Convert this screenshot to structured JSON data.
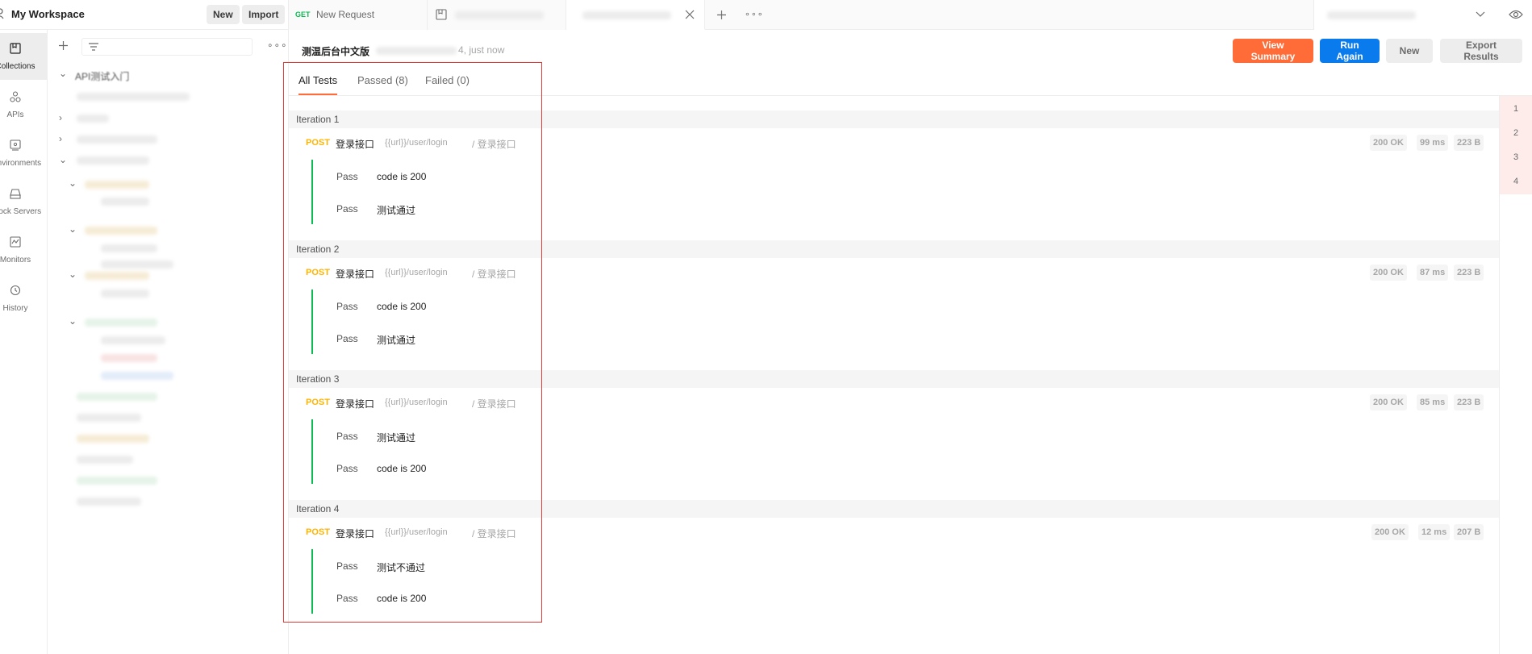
{
  "workspace": {
    "title": "My Workspace",
    "new_label": "New",
    "import_label": "Import"
  },
  "rail": [
    {
      "label": "Collections",
      "icon": "collections-icon"
    },
    {
      "label": "APIs",
      "icon": "apis-icon"
    },
    {
      "label": "Environments",
      "icon": "environments-icon"
    },
    {
      "label": "Mock Servers",
      "icon": "mock-servers-icon"
    },
    {
      "label": "Monitors",
      "icon": "monitors-icon"
    },
    {
      "label": "History",
      "icon": "history-icon"
    }
  ],
  "collections": {
    "first_label": "API测试入门"
  },
  "tabs": [
    {
      "method": "GET",
      "name": "New Request"
    }
  ],
  "runner": {
    "title": "测温后台中文版",
    "meta": "4, just now",
    "view_summary": "View Summary",
    "run_again": "Run Again",
    "new_label": "New",
    "export": "Export Results"
  },
  "result_tabs": {
    "all": "All Tests",
    "passed": "Passed (8)",
    "failed": "Failed (0)"
  },
  "iterations": [
    {
      "label": "Iteration 1",
      "method": "POST",
      "name": "登录接口",
      "url": "{{url}}/user/login",
      "path": "/ 登录接口",
      "status": "200 OK",
      "time": "99 ms",
      "size": "223 B",
      "tests": [
        {
          "result": "Pass",
          "name": "code is 200"
        },
        {
          "result": "Pass",
          "name": "测试通过"
        }
      ]
    },
    {
      "label": "Iteration 2",
      "method": "POST",
      "name": "登录接口",
      "url": "{{url}}/user/login",
      "path": "/ 登录接口",
      "status": "200 OK",
      "time": "87 ms",
      "size": "223 B",
      "tests": [
        {
          "result": "Pass",
          "name": "code is 200"
        },
        {
          "result": "Pass",
          "name": "测试通过"
        }
      ]
    },
    {
      "label": "Iteration 3",
      "method": "POST",
      "name": "登录接口",
      "url": "{{url}}/user/login",
      "path": "/ 登录接口",
      "status": "200 OK",
      "time": "85 ms",
      "size": "223 B",
      "tests": [
        {
          "result": "Pass",
          "name": "测试通过"
        },
        {
          "result": "Pass",
          "name": "code is 200"
        }
      ]
    },
    {
      "label": "Iteration 4",
      "method": "POST",
      "name": "登录接口",
      "url": "{{url}}/user/login",
      "path": "/ 登录接口",
      "status": "200 OK",
      "time": "12 ms",
      "size": "207 B",
      "tests": [
        {
          "result": "Pass",
          "name": "测试不通过"
        },
        {
          "result": "Pass",
          "name": "code is 200"
        }
      ]
    }
  ],
  "gutter": [
    "1",
    "2",
    "3",
    "4"
  ],
  "colors": {
    "accent": "#ff6c37",
    "primary": "#097bed",
    "pass": "#0cbb52",
    "post": "#ffb400",
    "highlight": "#e53935"
  }
}
